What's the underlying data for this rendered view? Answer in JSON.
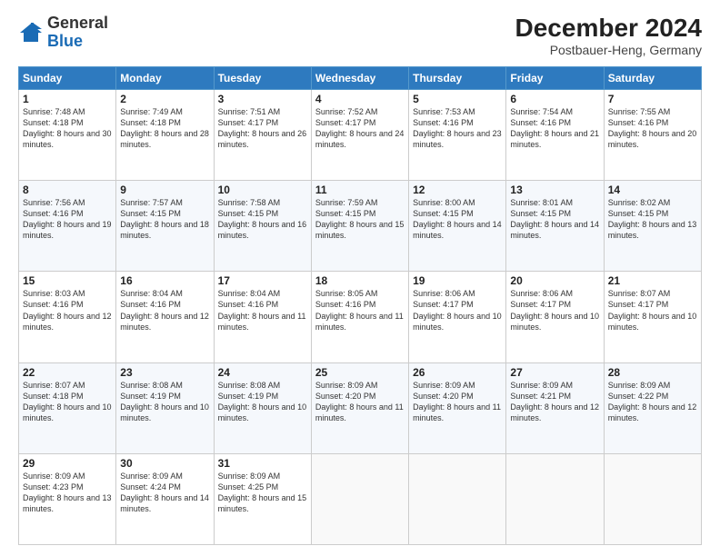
{
  "logo": {
    "text_general": "General",
    "text_blue": "Blue"
  },
  "title": "December 2024",
  "subtitle": "Postbauer-Heng, Germany",
  "days_of_week": [
    "Sunday",
    "Monday",
    "Tuesday",
    "Wednesday",
    "Thursday",
    "Friday",
    "Saturday"
  ],
  "weeks": [
    [
      {
        "day": "1",
        "sunrise": "Sunrise: 7:48 AM",
        "sunset": "Sunset: 4:18 PM",
        "daylight": "Daylight: 8 hours and 30 minutes."
      },
      {
        "day": "2",
        "sunrise": "Sunrise: 7:49 AM",
        "sunset": "Sunset: 4:18 PM",
        "daylight": "Daylight: 8 hours and 28 minutes."
      },
      {
        "day": "3",
        "sunrise": "Sunrise: 7:51 AM",
        "sunset": "Sunset: 4:17 PM",
        "daylight": "Daylight: 8 hours and 26 minutes."
      },
      {
        "day": "4",
        "sunrise": "Sunrise: 7:52 AM",
        "sunset": "Sunset: 4:17 PM",
        "daylight": "Daylight: 8 hours and 24 minutes."
      },
      {
        "day": "5",
        "sunrise": "Sunrise: 7:53 AM",
        "sunset": "Sunset: 4:16 PM",
        "daylight": "Daylight: 8 hours and 23 minutes."
      },
      {
        "day": "6",
        "sunrise": "Sunrise: 7:54 AM",
        "sunset": "Sunset: 4:16 PM",
        "daylight": "Daylight: 8 hours and 21 minutes."
      },
      {
        "day": "7",
        "sunrise": "Sunrise: 7:55 AM",
        "sunset": "Sunset: 4:16 PM",
        "daylight": "Daylight: 8 hours and 20 minutes."
      }
    ],
    [
      {
        "day": "8",
        "sunrise": "Sunrise: 7:56 AM",
        "sunset": "Sunset: 4:16 PM",
        "daylight": "Daylight: 8 hours and 19 minutes."
      },
      {
        "day": "9",
        "sunrise": "Sunrise: 7:57 AM",
        "sunset": "Sunset: 4:15 PM",
        "daylight": "Daylight: 8 hours and 18 minutes."
      },
      {
        "day": "10",
        "sunrise": "Sunrise: 7:58 AM",
        "sunset": "Sunset: 4:15 PM",
        "daylight": "Daylight: 8 hours and 16 minutes."
      },
      {
        "day": "11",
        "sunrise": "Sunrise: 7:59 AM",
        "sunset": "Sunset: 4:15 PM",
        "daylight": "Daylight: 8 hours and 15 minutes."
      },
      {
        "day": "12",
        "sunrise": "Sunrise: 8:00 AM",
        "sunset": "Sunset: 4:15 PM",
        "daylight": "Daylight: 8 hours and 14 minutes."
      },
      {
        "day": "13",
        "sunrise": "Sunrise: 8:01 AM",
        "sunset": "Sunset: 4:15 PM",
        "daylight": "Daylight: 8 hours and 14 minutes."
      },
      {
        "day": "14",
        "sunrise": "Sunrise: 8:02 AM",
        "sunset": "Sunset: 4:15 PM",
        "daylight": "Daylight: 8 hours and 13 minutes."
      }
    ],
    [
      {
        "day": "15",
        "sunrise": "Sunrise: 8:03 AM",
        "sunset": "Sunset: 4:16 PM",
        "daylight": "Daylight: 8 hours and 12 minutes."
      },
      {
        "day": "16",
        "sunrise": "Sunrise: 8:04 AM",
        "sunset": "Sunset: 4:16 PM",
        "daylight": "Daylight: 8 hours and 12 minutes."
      },
      {
        "day": "17",
        "sunrise": "Sunrise: 8:04 AM",
        "sunset": "Sunset: 4:16 PM",
        "daylight": "Daylight: 8 hours and 11 minutes."
      },
      {
        "day": "18",
        "sunrise": "Sunrise: 8:05 AM",
        "sunset": "Sunset: 4:16 PM",
        "daylight": "Daylight: 8 hours and 11 minutes."
      },
      {
        "day": "19",
        "sunrise": "Sunrise: 8:06 AM",
        "sunset": "Sunset: 4:17 PM",
        "daylight": "Daylight: 8 hours and 10 minutes."
      },
      {
        "day": "20",
        "sunrise": "Sunrise: 8:06 AM",
        "sunset": "Sunset: 4:17 PM",
        "daylight": "Daylight: 8 hours and 10 minutes."
      },
      {
        "day": "21",
        "sunrise": "Sunrise: 8:07 AM",
        "sunset": "Sunset: 4:17 PM",
        "daylight": "Daylight: 8 hours and 10 minutes."
      }
    ],
    [
      {
        "day": "22",
        "sunrise": "Sunrise: 8:07 AM",
        "sunset": "Sunset: 4:18 PM",
        "daylight": "Daylight: 8 hours and 10 minutes."
      },
      {
        "day": "23",
        "sunrise": "Sunrise: 8:08 AM",
        "sunset": "Sunset: 4:19 PM",
        "daylight": "Daylight: 8 hours and 10 minutes."
      },
      {
        "day": "24",
        "sunrise": "Sunrise: 8:08 AM",
        "sunset": "Sunset: 4:19 PM",
        "daylight": "Daylight: 8 hours and 10 minutes."
      },
      {
        "day": "25",
        "sunrise": "Sunrise: 8:09 AM",
        "sunset": "Sunset: 4:20 PM",
        "daylight": "Daylight: 8 hours and 11 minutes."
      },
      {
        "day": "26",
        "sunrise": "Sunrise: 8:09 AM",
        "sunset": "Sunset: 4:20 PM",
        "daylight": "Daylight: 8 hours and 11 minutes."
      },
      {
        "day": "27",
        "sunrise": "Sunrise: 8:09 AM",
        "sunset": "Sunset: 4:21 PM",
        "daylight": "Daylight: 8 hours and 12 minutes."
      },
      {
        "day": "28",
        "sunrise": "Sunrise: 8:09 AM",
        "sunset": "Sunset: 4:22 PM",
        "daylight": "Daylight: 8 hours and 12 minutes."
      }
    ],
    [
      {
        "day": "29",
        "sunrise": "Sunrise: 8:09 AM",
        "sunset": "Sunset: 4:23 PM",
        "daylight": "Daylight: 8 hours and 13 minutes."
      },
      {
        "day": "30",
        "sunrise": "Sunrise: 8:09 AM",
        "sunset": "Sunset: 4:24 PM",
        "daylight": "Daylight: 8 hours and 14 minutes."
      },
      {
        "day": "31",
        "sunrise": "Sunrise: 8:09 AM",
        "sunset": "Sunset: 4:25 PM",
        "daylight": "Daylight: 8 hours and 15 minutes."
      },
      null,
      null,
      null,
      null
    ]
  ]
}
